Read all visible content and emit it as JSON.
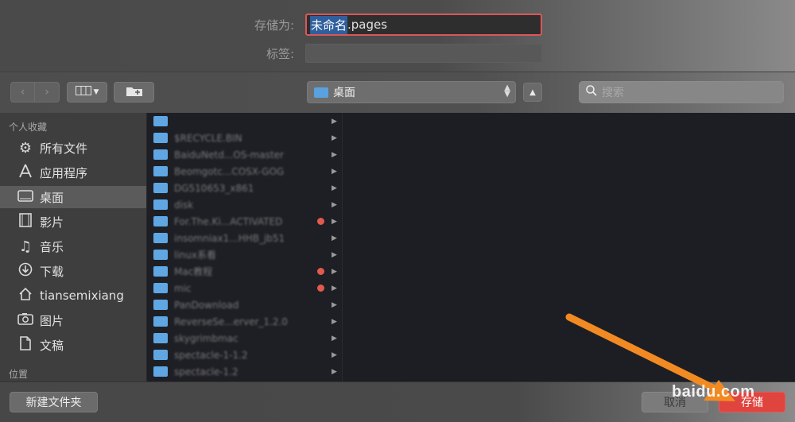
{
  "save_form": {
    "save_as_label": "存储为:",
    "file_name_selected": "未命名",
    "file_name_ext": ".pages",
    "tags_label": "标签:",
    "tags_value": ""
  },
  "toolbar": {
    "back": "‹",
    "forward": "›",
    "view_icon": "columns-view-icon",
    "new_folder_icon": "new-folder-icon",
    "location": "桌面",
    "expand_icon": "chevron-up-icon",
    "search_placeholder": "搜索"
  },
  "sidebar": {
    "favorites_header": "个人收藏",
    "items": [
      {
        "label": "所有文件",
        "icon": "gear-icon"
      },
      {
        "label": "应用程序",
        "icon": "applications-icon"
      },
      {
        "label": "桌面",
        "icon": "desktop-icon",
        "selected": true
      },
      {
        "label": "影片",
        "icon": "film-icon"
      },
      {
        "label": "音乐",
        "icon": "music-icon"
      },
      {
        "label": "下载",
        "icon": "download-icon"
      },
      {
        "label": "tiansemixiang",
        "icon": "home-icon"
      },
      {
        "label": "图片",
        "icon": "camera-icon"
      },
      {
        "label": "文稿",
        "icon": "document-icon"
      }
    ],
    "locations_header": "位置"
  },
  "files": [
    {
      "name": "",
      "dot": false
    },
    {
      "name": "$RECYCLE.BIN",
      "dot": false
    },
    {
      "name": "BaiduNetd...OS-master",
      "dot": false
    },
    {
      "name": "Beomgotc...COSX-GOG",
      "dot": false
    },
    {
      "name": "DG510653_x861",
      "dot": false
    },
    {
      "name": "disk",
      "dot": false
    },
    {
      "name": "For.The.Ki...ACTIVATED",
      "dot": true
    },
    {
      "name": "insomniax1...HHB_jb51",
      "dot": false
    },
    {
      "name": "linux系看",
      "dot": false
    },
    {
      "name": "Mac教程",
      "dot": true
    },
    {
      "name": "mic",
      "dot": true
    },
    {
      "name": "PanDownload",
      "dot": false
    },
    {
      "name": "ReverseSe...erver_1.2.0",
      "dot": false
    },
    {
      "name": "skygrimbmac",
      "dot": false
    },
    {
      "name": "spectacle-1-1.2",
      "dot": false
    },
    {
      "name": "spectacle-1.2",
      "dot": false
    }
  ],
  "bottom": {
    "new_folder": "新建文件夹",
    "cancel": "取消",
    "save": "存储"
  },
  "watermark": "baidu.com",
  "colors": {
    "save_button": "#e0443e",
    "folder": "#5fa6e3",
    "tag_dot": "#e25a4e",
    "arrow": "#f28a23"
  }
}
